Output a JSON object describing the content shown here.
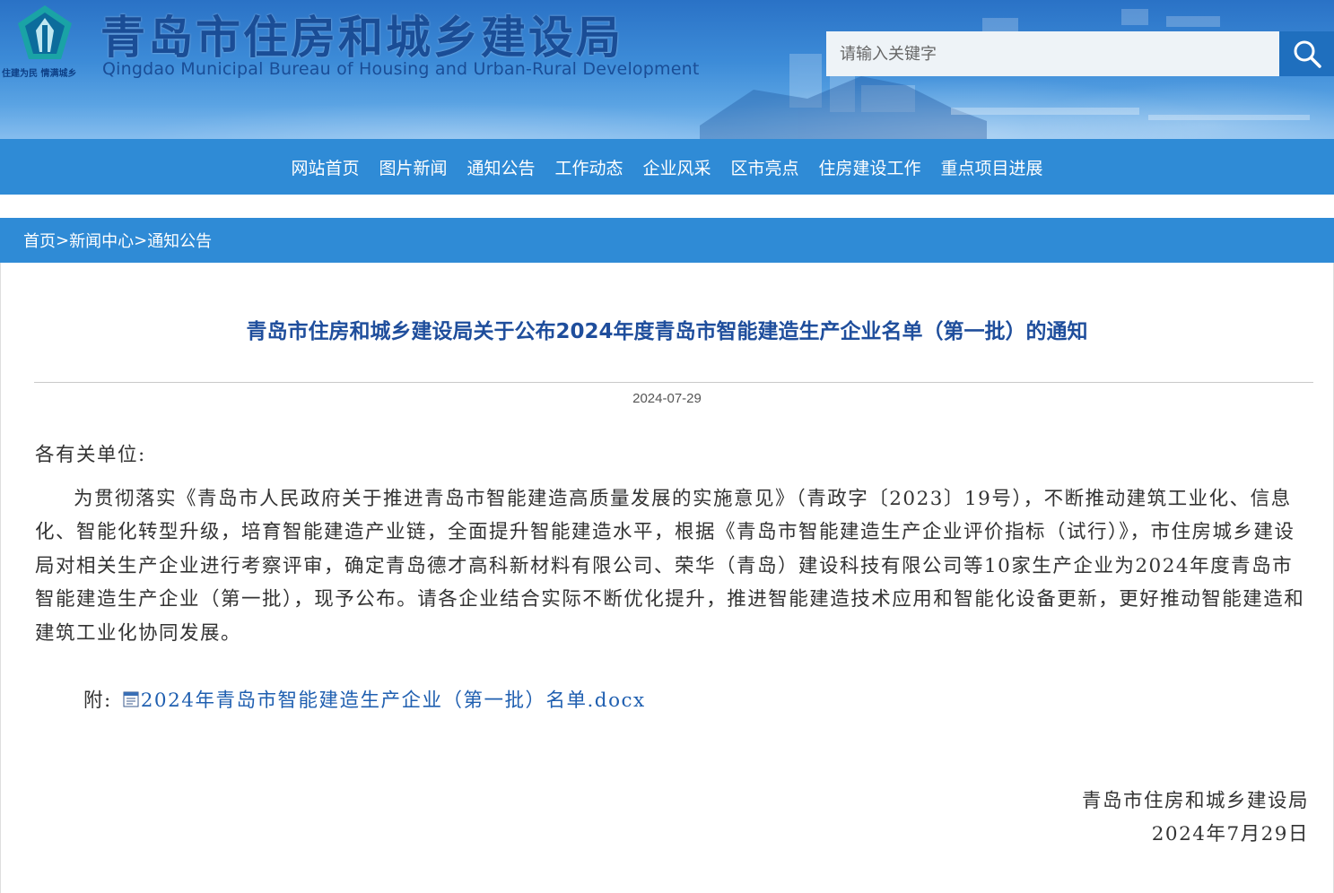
{
  "header": {
    "site_title": "青岛市住房和城乡建设局",
    "site_subtitle": "Qingdao Municipal Bureau of Housing and Urban-Rural Development",
    "logo_slogan": "住建为民 情满城乡",
    "search": {
      "placeholder": "请输入关键字"
    }
  },
  "nav": {
    "items": [
      {
        "label": "网站首页"
      },
      {
        "label": "图片新闻"
      },
      {
        "label": "通知公告"
      },
      {
        "label": "工作动态"
      },
      {
        "label": "企业风采"
      },
      {
        "label": "区市亮点"
      },
      {
        "label": "住房建设工作"
      },
      {
        "label": "重点项目进展"
      }
    ]
  },
  "breadcrumb": {
    "items": [
      {
        "label": "首页"
      },
      {
        "label": "新闻中心"
      },
      {
        "label": "通知公告"
      }
    ],
    "separator": ">"
  },
  "article": {
    "title": "青岛市住房和城乡建设局关于公布2024年度青岛市智能建造生产企业名单（第一批）的通知",
    "date": "2024-07-29",
    "salutation": "各有关单位:",
    "paragraph": "为贯彻落实《青岛市人民政府关于推进青岛市智能建造高质量发展的实施意见》（青政字〔2023〕19号），不断推动建筑工业化、信息化、智能化转型升级，培育智能建造产业链，全面提升智能建造水平，根据《青岛市智能建造生产企业评价指标（试行）》，市住房城乡建设局对相关生产企业进行考察评审，确定青岛德才高科新材料有限公司、荣华（青岛）建设科技有限公司等10家生产企业为2024年度青岛市智能建造生产企业（第一批），现予公布。请各企业结合实际不断优化提升，推进智能建造技术应用和智能化设备更新，更好推动智能建造和建筑工业化协同发展。",
    "attachment_label": "附:",
    "attachment_link": "2024年青岛市智能建造生产企业（第一批）名单.docx",
    "signature_org": "青岛市住房和城乡建设局",
    "signature_date": "2024年7月29日"
  },
  "colors": {
    "nav_bg": "#2f8bd6",
    "title_blue": "#1f4e9c",
    "link_blue": "#1f5fb0"
  },
  "icons": {
    "search": "search-icon",
    "logo": "pagoda-logo-icon",
    "attachment": "word-document-icon"
  }
}
